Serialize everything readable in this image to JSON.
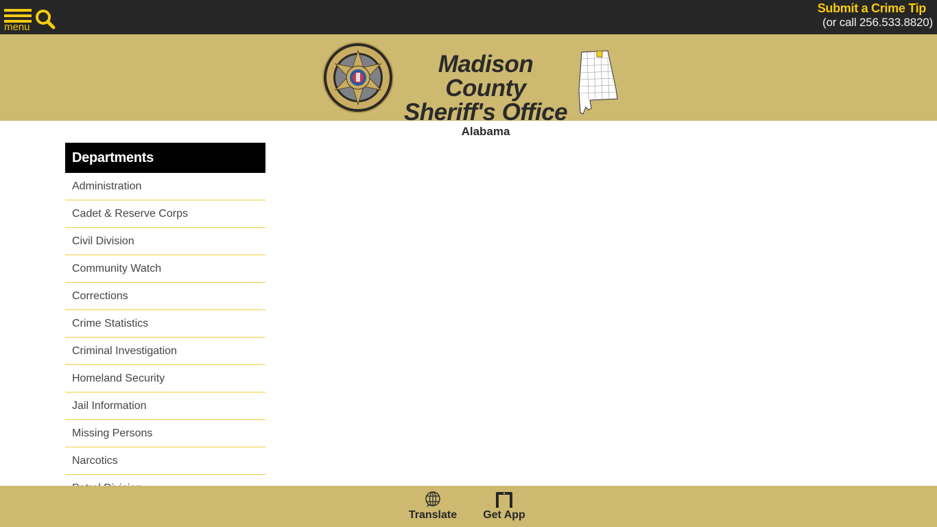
{
  "topbar": {
    "menu_label": "menu",
    "menu_icon": "hamburger-icon",
    "search_icon": "search-icon",
    "tip_title": "Submit a Crime Tip",
    "tip_phone": "(or call 256.533.8820)"
  },
  "banner": {
    "seal_icon": "sheriff-seal-icon",
    "title_line1": "Madison County",
    "title_line2": "Sheriff's Office",
    "subtitle": "Alabama",
    "map_icon": "alabama-county-map-icon"
  },
  "sidebar": {
    "heading": "Departments",
    "items": [
      {
        "label": "Administration"
      },
      {
        "label": "Cadet & Reserve Corps"
      },
      {
        "label": "Civil Division"
      },
      {
        "label": "Community Watch"
      },
      {
        "label": "Corrections"
      },
      {
        "label": "Crime Statistics"
      },
      {
        "label": "Criminal Investigation"
      },
      {
        "label": "Homeland Security"
      },
      {
        "label": "Jail Information"
      },
      {
        "label": "Missing Persons"
      },
      {
        "label": "Narcotics"
      },
      {
        "label": "Patrol Division"
      }
    ]
  },
  "footer": {
    "translate_label": "Translate",
    "translate_icon": "globe-icon",
    "app_label": "Get App",
    "app_icon": "phone-icon"
  },
  "colors": {
    "topbar_bg": "#262626",
    "accent_yellow": "#f5cb10",
    "banner_gold": "#cdb970",
    "divider_yellow": "#f1cf3a"
  }
}
